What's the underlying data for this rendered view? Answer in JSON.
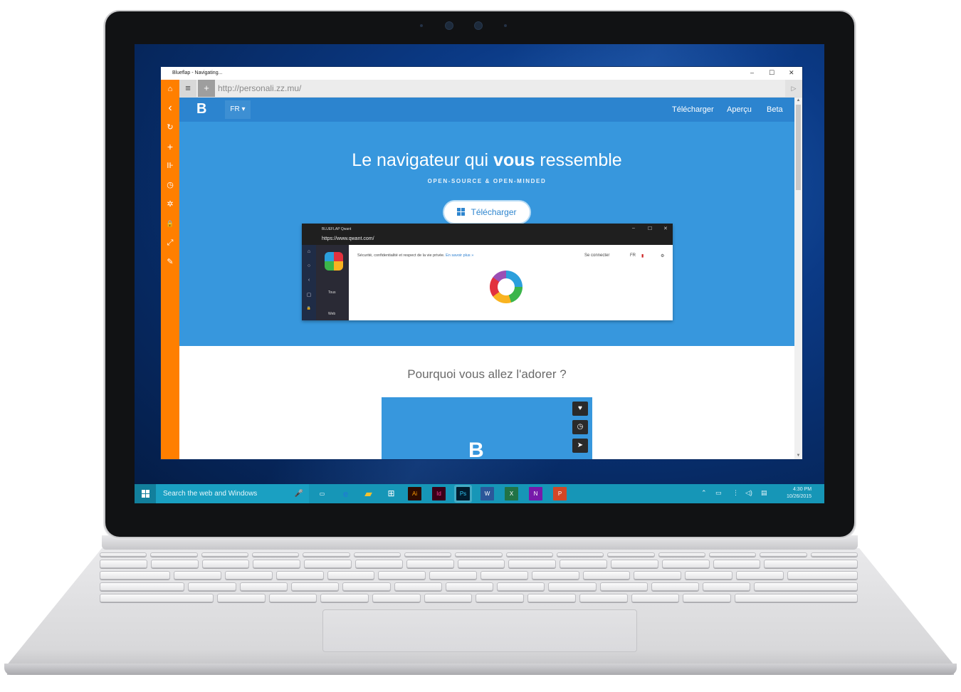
{
  "window": {
    "title": "Blueflap - Navigating...",
    "controls": [
      "–",
      "☐",
      "✕"
    ]
  },
  "toolbar": {
    "menu_icon": "≡",
    "add_icon": "+",
    "url": "http://personali.zz.mu/",
    "go_icon": "▷"
  },
  "sidebar": {
    "items": [
      {
        "icon": "home-icon",
        "glyph": "⌂"
      },
      {
        "icon": "back-icon",
        "glyph": "‹"
      },
      {
        "icon": "refresh-icon",
        "glyph": "↻"
      },
      {
        "icon": "add-icon",
        "glyph": "+"
      },
      {
        "icon": "split-icon",
        "glyph": "⊪"
      },
      {
        "icon": "history-icon",
        "glyph": "◷"
      },
      {
        "icon": "settings-icon",
        "glyph": "✲"
      },
      {
        "icon": "lock-icon",
        "glyph": "🔒"
      },
      {
        "icon": "fullscreen-icon",
        "glyph": "⤢"
      },
      {
        "icon": "notes-icon",
        "glyph": "✎"
      }
    ]
  },
  "site": {
    "logo": "B",
    "lang": "FR ▾",
    "nav": [
      "Télécharger",
      "Aperçu",
      "Beta"
    ],
    "headline_pre": "Le navigateur qui ",
    "headline_bold": "vous",
    "headline_post": " ressemble",
    "subline": "OPEN-SOURCE & OPEN-MINDED",
    "download_button": "Télécharger",
    "why_title": "Pourquoi vous allez l'adorer ?",
    "card_icons": [
      "♥",
      "◷",
      "➤"
    ]
  },
  "inner_screenshot": {
    "title": "BLUEFLAP Qwant",
    "url": "https://www.qwant.com/",
    "controls": [
      "–",
      "☐",
      "✕"
    ],
    "message": "Sécurité, confidentialité et respect de la vie privée.",
    "message_link": "En savoir plus »",
    "connect": "Se connecter",
    "lang": "FR",
    "cat_all": "Tous",
    "cat_web": "Web",
    "side_glyphs": [
      "⌂",
      "○",
      "‹",
      "▢",
      "🔒"
    ]
  },
  "taskbar": {
    "search_placeholder": "Search the web and Windows",
    "apps": [
      {
        "name": "task-view",
        "label": "▭",
        "color": "transparent"
      },
      {
        "name": "edge",
        "label": "e",
        "color": "transparent"
      },
      {
        "name": "explorer",
        "label": "▰",
        "color": "#f2c12e"
      },
      {
        "name": "store",
        "label": "⊞",
        "color": "transparent"
      },
      {
        "name": "illustrator",
        "label": "Ai",
        "color": "#2d0b00"
      },
      {
        "name": "indesign",
        "label": "Id",
        "color": "#3b0018"
      },
      {
        "name": "photoshop",
        "label": "Ps",
        "color": "#001c2e"
      },
      {
        "name": "word",
        "label": "W",
        "color": "#2b579a"
      },
      {
        "name": "excel",
        "label": "X",
        "color": "#217346"
      },
      {
        "name": "onenote",
        "label": "N",
        "color": "#7719aa"
      },
      {
        "name": "powerpoint",
        "label": "P",
        "color": "#d24726"
      }
    ],
    "time": "4:30 PM",
    "date": "10/26/2015"
  },
  "colors": {
    "accent_orange": "#ff7f00",
    "hero_blue": "#3797dd",
    "nav_blue": "#2c84cf",
    "taskbar": "#1696b7"
  }
}
